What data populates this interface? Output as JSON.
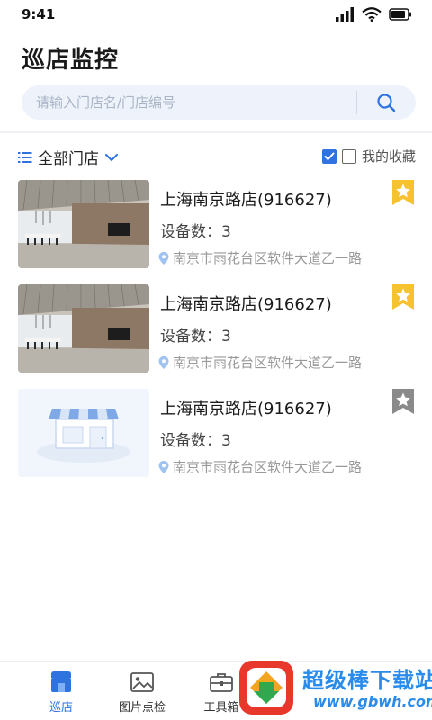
{
  "status_bar": {
    "time": "9:41"
  },
  "header": {
    "title": "巡店监控"
  },
  "search": {
    "placeholder": "请输入门店名/门店编号",
    "value": ""
  },
  "filter": {
    "dropdown_label": "全部门店",
    "favorites_label": "我的收藏",
    "favorites_checked": false
  },
  "stores": [
    {
      "name": "上海南京路店(916627)",
      "devices": "设备数：3",
      "address": "南京市雨花台区软件大道乙一路",
      "favorited": true,
      "thumb": "store-photo"
    },
    {
      "name": "上海南京路店(916627)",
      "devices": "设备数：3",
      "address": "南京市雨花台区软件大道乙一路",
      "favorited": true,
      "thumb": "store-photo"
    },
    {
      "name": "上海南京路店(916627)",
      "devices": "设备数：3",
      "address": "南京市雨花台区软件大道乙一路",
      "favorited": false,
      "thumb": "store-placeholder-icon"
    }
  ],
  "tab_bar": {
    "tabs": [
      {
        "label": "巡店",
        "icon": "store-icon",
        "active": true
      },
      {
        "label": "图片点检",
        "icon": "image-icon",
        "active": false
      },
      {
        "label": "工具箱",
        "icon": "toolbox-icon",
        "active": false
      }
    ]
  },
  "watermark": {
    "title": "超级棒下载站",
    "url": "www.gbwh.com"
  },
  "colors": {
    "accent": "#2f73e0",
    "star_active": "#f5c330",
    "star_inactive": "#8a8a8a"
  }
}
